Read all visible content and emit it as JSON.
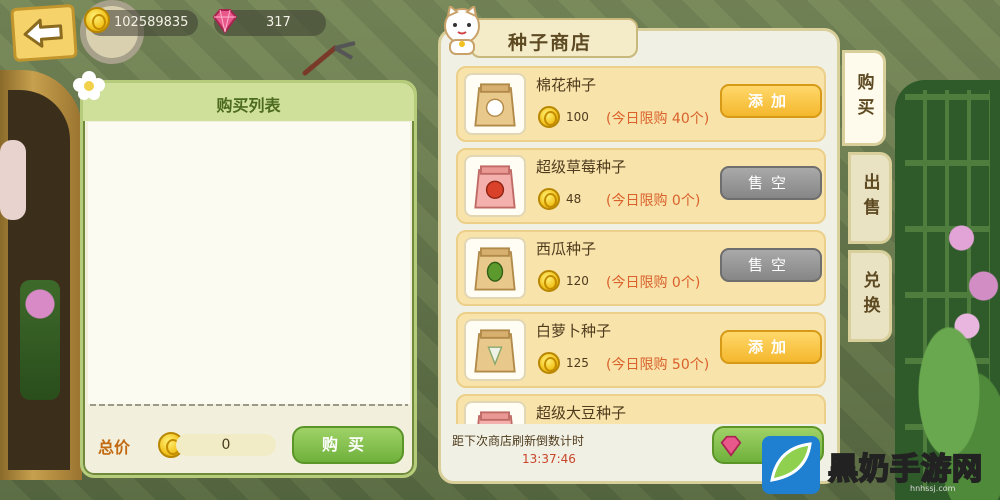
{
  "top_bar": {
    "back_icon": "back-arrow-icon",
    "coins": "102589835",
    "gems": "317"
  },
  "buy_panel": {
    "title": "购买列表",
    "total_label": "总价",
    "total_value": "0",
    "buy_button": "购买"
  },
  "shop": {
    "title": "种子商店",
    "items": [
      {
        "name": "棉花种子",
        "price": "100",
        "limit": "(今日限购 40个)",
        "action": "添加",
        "state": "add",
        "seed_color": "#ffffff"
      },
      {
        "name": "超级草莓种子",
        "price": "48",
        "limit": "(今日限购 0个)",
        "action": "售空",
        "state": "sold",
        "seed_color": "#d9412b"
      },
      {
        "name": "西瓜种子",
        "price": "120",
        "limit": "(今日限购 0个)",
        "action": "售空",
        "state": "sold",
        "seed_color": "#5d9a2e"
      },
      {
        "name": "白萝卜种子",
        "price": "125",
        "limit": "(今日限购 50个)",
        "action": "添加",
        "state": "add",
        "seed_color": "#eef2e6"
      },
      {
        "name": "超级大豆种子",
        "price": "",
        "limit": "",
        "action": "",
        "state": "add",
        "seed_color": "#c9b35a"
      }
    ],
    "refresh_label": "距下次商店刷新倒数计时",
    "refresh_time": "13:37:46"
  },
  "tabs": {
    "buy": "购买",
    "sell": "出售",
    "exchange": "兑换"
  },
  "watermark": {
    "text": "黑奶手游网",
    "url": "hnhssj.com"
  },
  "colors": {
    "add_button": "#f4b72c",
    "sold_button": "#868686",
    "buy_button": "#6fb13c",
    "limit_text": "#d9612b"
  }
}
